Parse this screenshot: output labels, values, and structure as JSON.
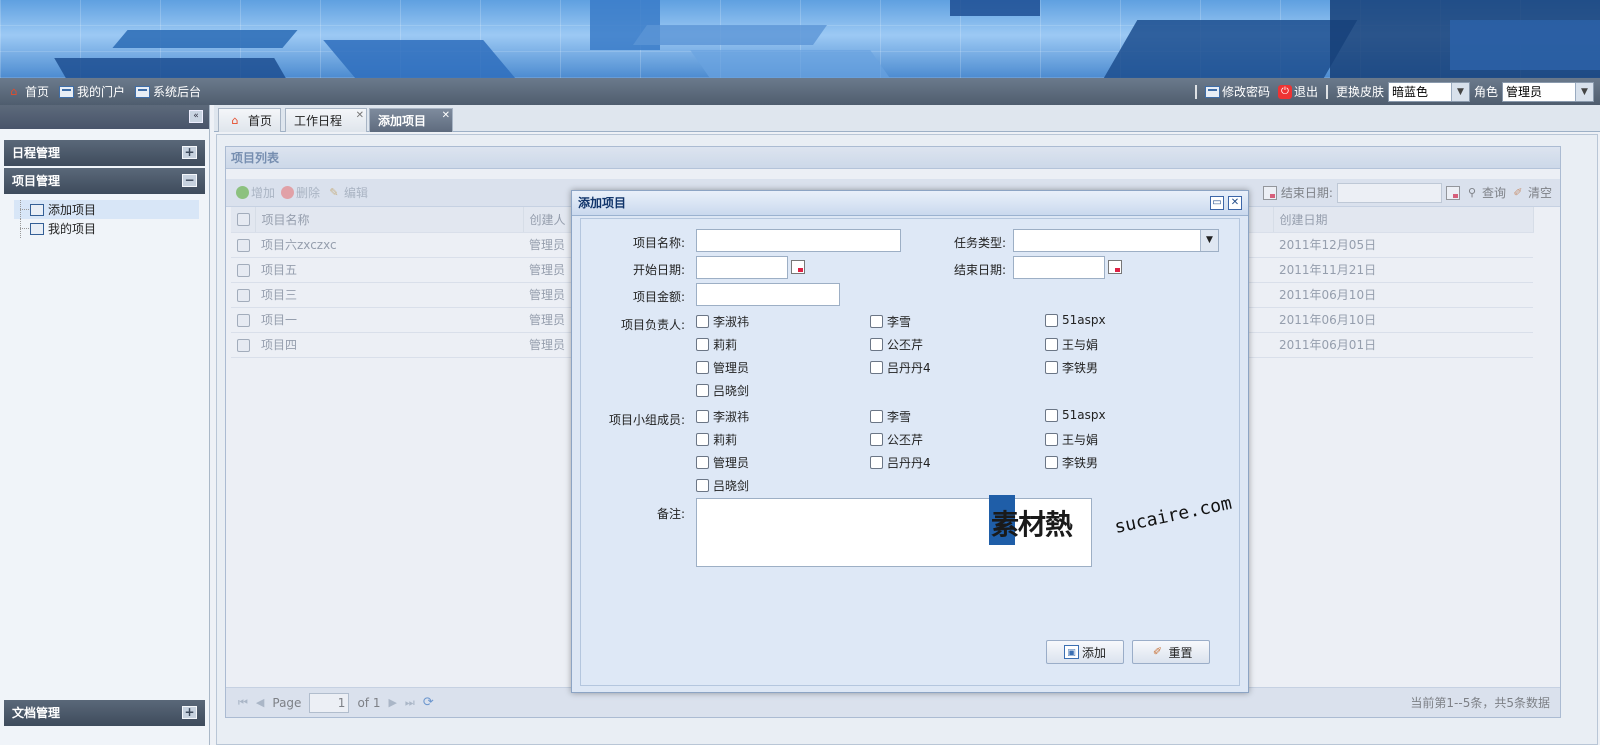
{
  "topnav": {
    "items": [
      {
        "label": "首页",
        "icon": "home-icon"
      },
      {
        "label": "我的门户",
        "icon": "portal-icon"
      },
      {
        "label": "系统后台",
        "icon": "portal-icon"
      }
    ],
    "change_password": "修改密码",
    "logout": "退出",
    "skin_label": "更换皮肤",
    "skin_value": "暗蓝色",
    "role_label": "角色",
    "role_value": "管理员"
  },
  "sidebar": {
    "sections": [
      {
        "title": "日程管理",
        "toggle": "+"
      },
      {
        "title": "项目管理",
        "toggle": "−"
      },
      {
        "title": "文档管理",
        "toggle": "+"
      }
    ],
    "items": [
      {
        "label": "添加项目"
      },
      {
        "label": "我的项目"
      }
    ]
  },
  "tabs": [
    {
      "label": "首页"
    },
    {
      "label": "工作日程"
    },
    {
      "label": "添加项目"
    }
  ],
  "panel": {
    "title": "项目列表",
    "toolbar": {
      "add": "增加",
      "delete": "删除",
      "edit": "编辑",
      "end_date_label": "结束日期:",
      "query": "查询",
      "clear": "清空"
    },
    "columns": [
      "项目名称",
      "创建人",
      "创建日期"
    ],
    "rows": [
      {
        "name": "项目六zxczxc",
        "creator": "管理员",
        "date": "2011年12月05日"
      },
      {
        "name": "项目五",
        "creator": "管理员",
        "date": "2011年11月21日"
      },
      {
        "name": "项目三",
        "creator": "管理员",
        "date": "2011年06月10日"
      },
      {
        "name": "项目一",
        "creator": "管理员",
        "date": "2011年06月10日"
      },
      {
        "name": "项目四",
        "creator": "管理员",
        "date": "2011年06月01日"
      }
    ],
    "pager": {
      "page_label": "Page",
      "page_value": "1",
      "of_label": "of 1",
      "summary": "当前第1--5条，共5条数据"
    }
  },
  "dialog": {
    "title": "添加项目",
    "labels": {
      "name": "项目名称:",
      "task_type": "任务类型:",
      "start_date": "开始日期:",
      "end_date": "结束日期:",
      "amount": "项目金额:",
      "leader": "项目负责人:",
      "members": "项目小组成员:",
      "remark": "备注:"
    },
    "people": [
      "李淑祎",
      "李雪",
      "51aspx",
      "莉莉",
      "公丕芹",
      "王与娟",
      "管理员",
      "吕丹丹4",
      "李铁男",
      "吕晓剑"
    ],
    "buttons": {
      "add": "添加",
      "reset": "重置"
    }
  },
  "watermark": {
    "cn": "素材熱",
    "en": "sucaire.com"
  }
}
